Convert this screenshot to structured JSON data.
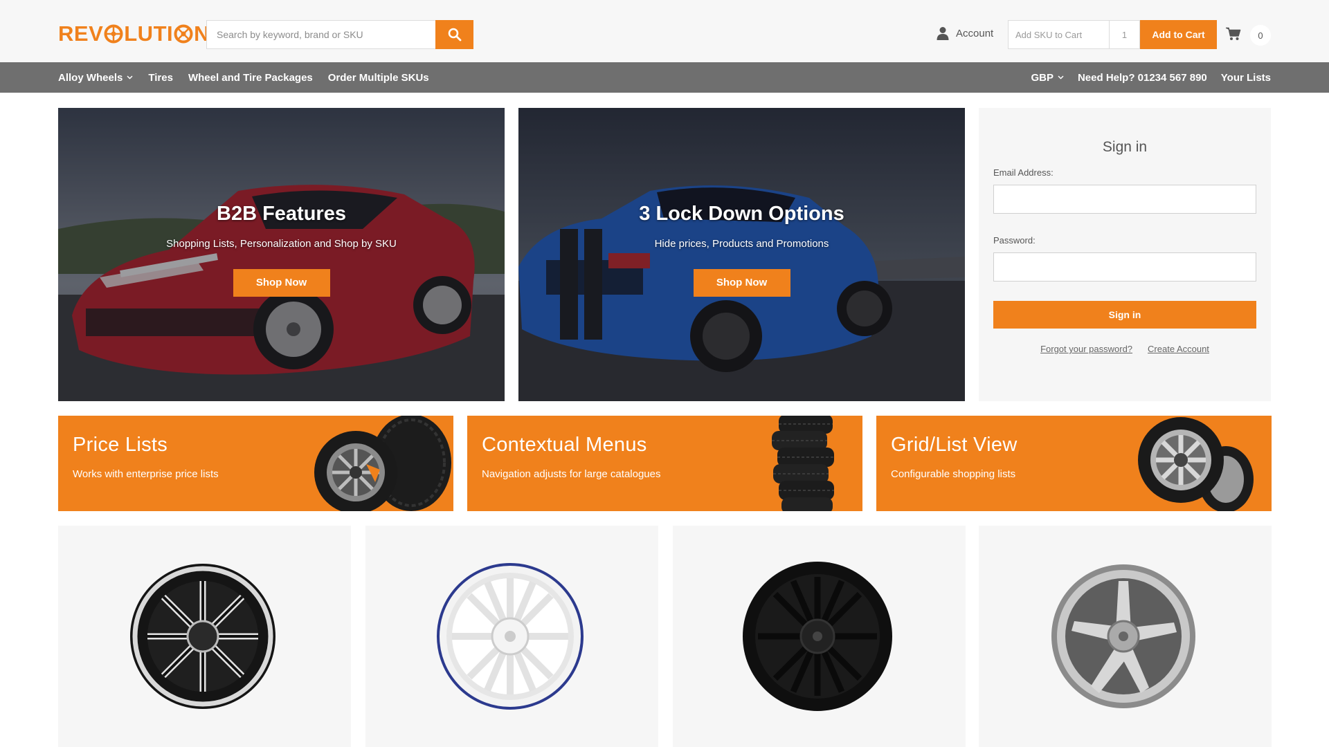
{
  "header": {
    "logo_text": "REVOLUTION",
    "search_placeholder": "Search by keyword, brand or SKU",
    "account_label": "Account",
    "quick_add": {
      "sku_placeholder": "Add SKU to Cart",
      "qty_value": "1",
      "add_label": "Add to Cart"
    },
    "cart_count": "0"
  },
  "nav": {
    "left": [
      {
        "label": "Alloy Wheels",
        "dropdown": true
      },
      {
        "label": "Tires"
      },
      {
        "label": "Wheel and Tire Packages"
      },
      {
        "label": "Order Multiple SKUs"
      }
    ],
    "right": [
      {
        "label": "GBP",
        "dropdown": true
      },
      {
        "label": "Need Help? 01234 567 890"
      },
      {
        "label": "Your Lists"
      }
    ]
  },
  "hero": [
    {
      "title": "B2B Features",
      "subtitle": "Shopping Lists, Personalization and Shop by SKU",
      "cta": "Shop Now",
      "car_color": "#b8202b"
    },
    {
      "title": "3 Lock Down Options",
      "subtitle": "Hide prices, Products and Promotions",
      "cta": "Shop Now",
      "car_color": "#1f5fc8"
    }
  ],
  "signin": {
    "title": "Sign in",
    "email_label": "Email Address:",
    "password_label": "Password:",
    "submit_label": "Sign in",
    "forgot_label": "Forgot your password?",
    "create_label": "Create Account"
  },
  "promos": [
    {
      "title": "Price Lists",
      "subtitle": "Works with enterprise price lists"
    },
    {
      "title": "Contextual Menus",
      "subtitle": "Navigation adjusts for large catalogues"
    },
    {
      "title": "Grid/List View",
      "subtitle": "Configurable shopping lists"
    }
  ],
  "products": [
    {
      "name": "black-chrome-multi-spoke-wheel"
    },
    {
      "name": "white-blue-lip-wheel"
    },
    {
      "name": "matte-black-spoke-wheel"
    },
    {
      "name": "silver-machined-wheel"
    }
  ],
  "colors": {
    "accent": "#f0811c",
    "nav_bg": "#6f6f6f",
    "header_bg": "#f7f7f7"
  }
}
